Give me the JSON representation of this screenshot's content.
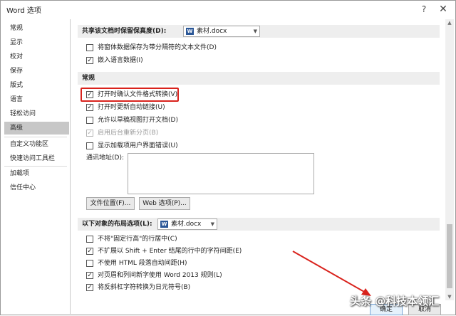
{
  "window": {
    "title": "Word 选项",
    "help_icon": "?",
    "close_icon": "✕"
  },
  "sidebar": {
    "items": [
      {
        "label": "常规"
      },
      {
        "label": "显示"
      },
      {
        "label": "校对"
      },
      {
        "label": "保存"
      },
      {
        "label": "版式"
      },
      {
        "label": "语言"
      },
      {
        "label": "轻松访问"
      },
      {
        "label": "高级",
        "selected": true
      },
      {
        "label": "自定义功能区"
      },
      {
        "label": "快速访问工具栏"
      },
      {
        "label": "加载项"
      },
      {
        "label": "信任中心"
      }
    ]
  },
  "share_section": {
    "header": "共享该文档时保留保真度(D):",
    "document": "素材.docx",
    "options": [
      {
        "label": "将窗体数据保存为带分隔符的文本文件(D)",
        "checked": false
      },
      {
        "label": "嵌入语言数据(I)",
        "checked": true
      }
    ]
  },
  "general_section": {
    "header": "常规",
    "options": [
      {
        "label": "打开时确认文件格式转换(V)",
        "checked": true
      },
      {
        "label": "打开时更新自动链接(U)",
        "checked": true
      },
      {
        "label": "允许以草稿视图打开文档(D)",
        "checked": false
      },
      {
        "label": "启用后台重新分页(B)",
        "checked": true,
        "disabled": true
      },
      {
        "label": "显示加载项用户界面错误(U)",
        "checked": false
      }
    ],
    "mailing_address_label": "通讯地址(D):",
    "file_locations_button": "文件位置(F)...",
    "web_options_button": "Web 选项(P)..."
  },
  "layout_section": {
    "header": "以下对象的布局选项(L):",
    "document": "素材.docx",
    "options": [
      {
        "label": "不将\"固定行高\"的行居中(C)",
        "checked": false
      },
      {
        "label": "不扩展以 Shift + Enter 结尾的行中的字符间距(E)",
        "checked": true
      },
      {
        "label": "不使用 HTML 段落自动间距(H)",
        "checked": false
      },
      {
        "label": "对页眉和列间新字使用 Word 2013 规则(L)",
        "checked": true
      },
      {
        "label": "将反斜杠字符转换为日元符号(B)",
        "checked": true
      }
    ]
  },
  "footer": {
    "ok_label": "确定",
    "cancel_label": "取消"
  },
  "watermark": "头条 @科技本领汇",
  "colors": {
    "highlight": "#d9221c",
    "selected_nav": "#c7c7c7",
    "section_bg": "#eeeeee"
  },
  "icons": {
    "checkmark": "✓",
    "caret": "▼",
    "doc": "W"
  }
}
